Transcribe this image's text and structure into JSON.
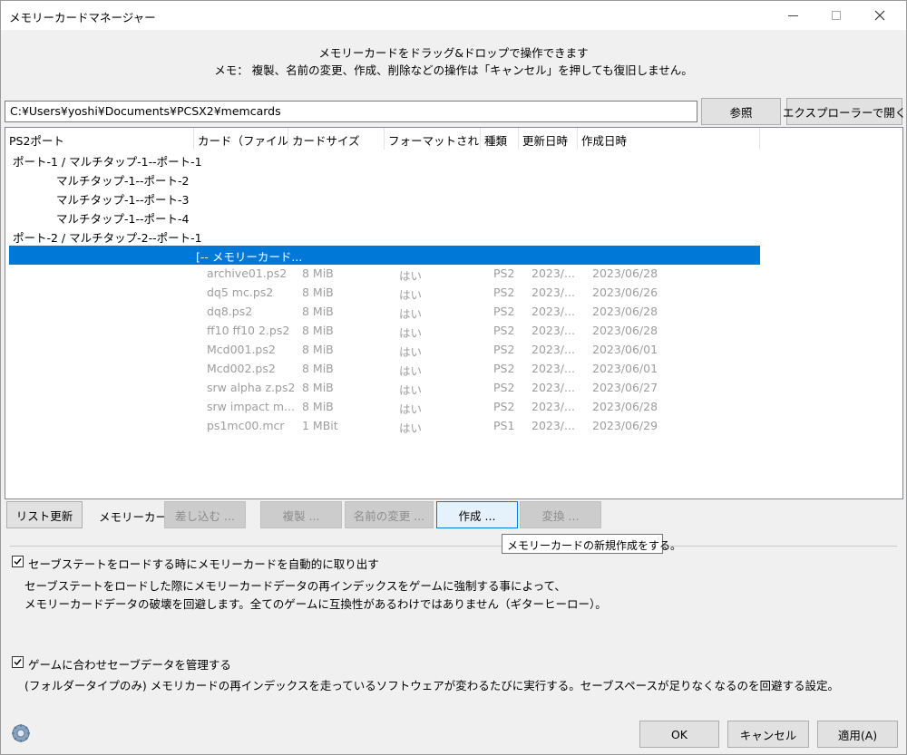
{
  "window": {
    "title": "メモリーカードマネージャー"
  },
  "info": {
    "line1": "メモリーカードをドラッグ&ドロップで操作できます",
    "line2": "メモ： 複製、名前の変更、作成、削除などの操作は「キャンセル」を押しても復旧しません。"
  },
  "path": {
    "value": "C:¥Users¥yoshi¥Documents¥PCSX2¥memcards"
  },
  "buttons": {
    "browse": "参照",
    "open_explorer": "エクスプローラーで開く",
    "refresh": "リスト更新",
    "insert": "差し込む ...",
    "duplicate": "複製 ...",
    "rename": "名前の変更 ...",
    "create": "作成 ...",
    "convert": "変換 ...",
    "ok": "OK",
    "cancel": "キャンセル",
    "apply": "適用(A)"
  },
  "memcard_label": "メモリーカード:",
  "tooltip": "メモリーカードの新規作成をする。",
  "list": {
    "headers": [
      "PS2ポート",
      "カード（ファイル...",
      "カードサイズ",
      "フォーマットされた",
      "種類",
      "更新日時",
      "作成日時"
    ],
    "ports": [
      "ポート-1 / マルチタップ-1--ポート-1",
      "マルチタップ-1--ポート-2",
      "マルチタップ-1--ポート-3",
      "マルチタップ-1--ポート-4",
      "ポート-2 / マルチタップ-2--ポート-1"
    ],
    "selected_row": "[-- メモリーカード...",
    "cards": [
      [
        "archive01.ps2",
        "8 MiB",
        "はい",
        "PS2",
        "2023/...",
        "2023/06/28"
      ],
      [
        "dq5 mc.ps2",
        "8 MiB",
        "はい",
        "PS2",
        "2023/...",
        "2023/06/26"
      ],
      [
        "dq8.ps2",
        "8 MiB",
        "はい",
        "PS2",
        "2023/...",
        "2023/06/28"
      ],
      [
        "ff10 ff10 2.ps2",
        "8 MiB",
        "はい",
        "PS2",
        "2023/...",
        "2023/06/28"
      ],
      [
        "Mcd001.ps2",
        "8 MiB",
        "はい",
        "PS2",
        "2023/...",
        "2023/06/01"
      ],
      [
        "Mcd002.ps2",
        "8 MiB",
        "はい",
        "PS2",
        "2023/...",
        "2023/06/01"
      ],
      [
        "srw alpha z.ps2",
        "8 MiB",
        "はい",
        "PS2",
        "2023/...",
        "2023/06/27"
      ],
      [
        "srw impact m...",
        "8 MiB",
        "はい",
        "PS2",
        "2023/...",
        "2023/06/28"
      ],
      [
        "ps1mc00.mcr",
        "1 MBit",
        "はい",
        "PS1",
        "2023/...",
        "2023/06/29"
      ]
    ]
  },
  "options": {
    "eject": {
      "label": "セーブステートをロードする時にメモリーカードを自動的に取り出す",
      "desc1": "セーブステートをロードした際にメモリーカードデータの再インデックスをゲームに強制する事によって、",
      "desc2": "メモリーカードデータの破壊を回避します。全てのゲームに互換性があるわけではありません（ギターヒーロー）。",
      "checked": true
    },
    "manage": {
      "label": "ゲームに合わせセーブデータを管理する",
      "desc": "(フォルダータイプのみ) メモリカードの再インデックスを走っているソフトウェアが変わるたびに実行する。セーブスペースが足りなくなるのを回避する設定。",
      "checked": true
    }
  },
  "colors": {
    "accent": "#0078d7",
    "disabled_text": "#9d9d9d"
  }
}
